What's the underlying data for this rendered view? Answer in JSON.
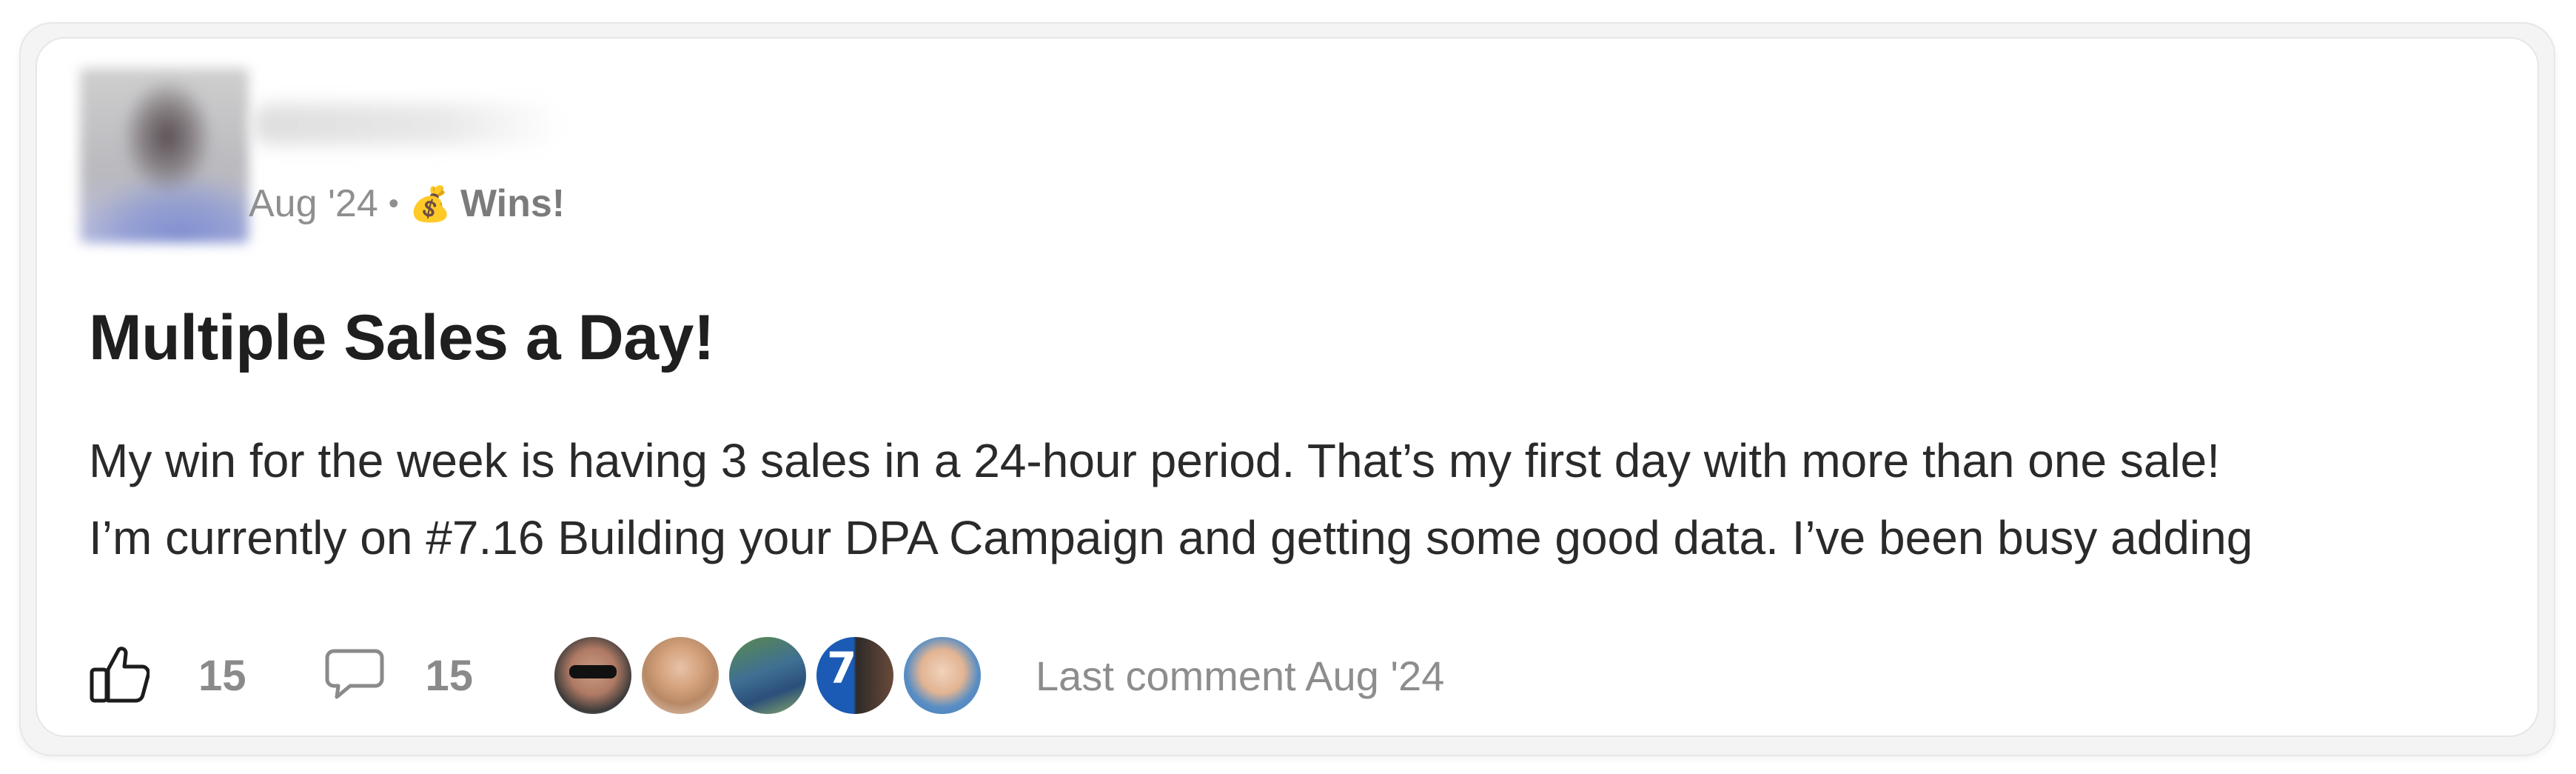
{
  "post": {
    "date": "Aug '24",
    "separator": "•",
    "category_emoji": "💰",
    "category": "Wins!",
    "title": "Multiple Sales a Day!",
    "body_lines": [
      "My win for the week is having 3 sales in a 24-hour period. That’s my first day with more than one sale!",
      "I’m currently on #7.16 Building your DPA Campaign and getting some good data. I’ve been busy adding"
    ]
  },
  "footer": {
    "like_count": "15",
    "comment_count": "15",
    "commenter_avatar_badge": "7",
    "last_comment": "Last comment Aug '24"
  },
  "icons": {
    "like": "thumbs-up-icon",
    "comment": "comment-bubble-icon"
  },
  "colors": {
    "card_bg": "#ffffff",
    "title": "#1f1f1f",
    "muted": "#8f8f8f"
  }
}
